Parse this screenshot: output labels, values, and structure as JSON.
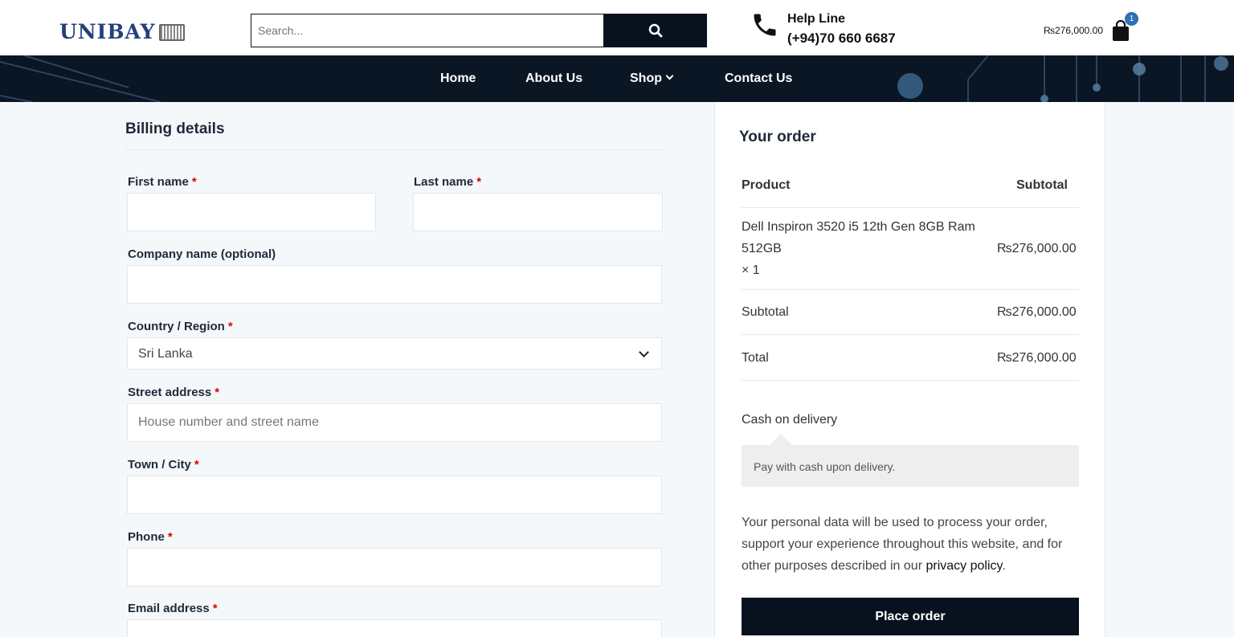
{
  "header": {
    "logo_text": "UNIBAY",
    "search_placeholder": "Search...",
    "help_label": "Help Line",
    "help_number": "(+94)70 660 6687",
    "cart_amount": "₨276,000.00",
    "cart_count": "1"
  },
  "nav": {
    "items": [
      "Home",
      "About Us",
      "Shop",
      "Contact Us"
    ]
  },
  "billing": {
    "title": "Billing details",
    "first_name_label": "First name",
    "last_name_label": "Last name",
    "company_label": "Company name (optional)",
    "country_label": "Country / Region",
    "country_value": "Sri Lanka",
    "street_label": "Street address",
    "street_placeholder": "House number and street name",
    "town_label": "Town / City",
    "phone_label": "Phone",
    "email_label": "Email address",
    "required_mark": "*"
  },
  "order": {
    "title": "Your order",
    "col_product": "Product",
    "col_subtotal": "Subtotal",
    "product_line1": "Dell Inspiron 3520 i5 12th Gen 8GB Ram",
    "product_line2": "512GB",
    "product_qty": "× 1",
    "product_price": "₨276,000.00",
    "subtotal_label": "Subtotal",
    "subtotal_value": "₨276,000.00",
    "total_label": "Total",
    "total_value": "₨276,000.00",
    "payment_method": "Cash on delivery",
    "payment_description": "Pay with cash upon delivery.",
    "privacy_text": "Your personal data will be used to process your order, support your experience throughout this website, and for other purposes described in our ",
    "privacy_link": "privacy policy",
    "privacy_end": ".",
    "place_order": "Place order"
  },
  "colors": {
    "brand_navy": "#24407a",
    "dark_bar": "#0a1624",
    "required": "#dd0000",
    "badge": "#2f6fb5"
  },
  "icons": [
    "search-icon",
    "phone-icon",
    "shopping-bag-icon",
    "chevron-down-icon"
  ]
}
